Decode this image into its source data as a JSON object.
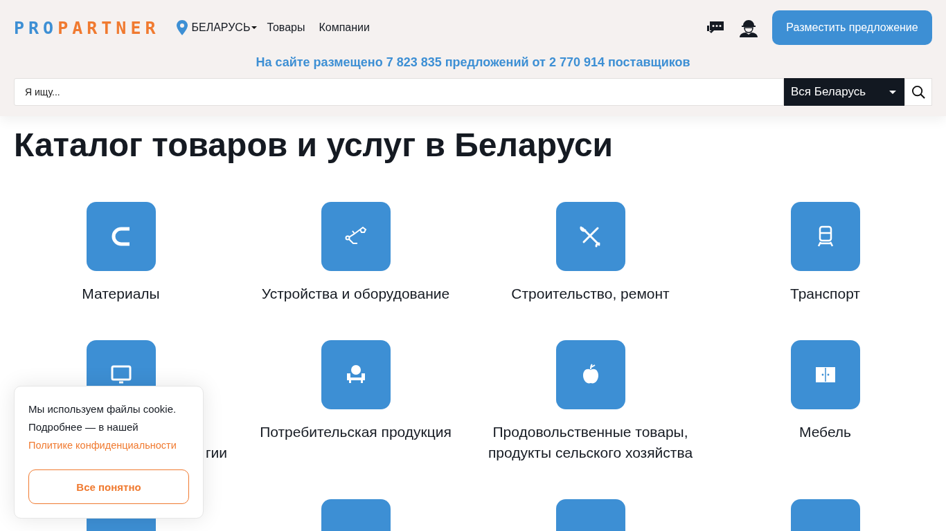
{
  "header": {
    "logo": {
      "part_1": "PRO",
      "part_2": "PARTNER"
    },
    "region": "БЕЛАРУСЬ",
    "nav": [
      "Товары",
      "Компании"
    ],
    "post_button": "Разместить предложение",
    "stats": "На сайте размещено 7 823 835 предложений от 2 770 914 поставщиков",
    "search": {
      "placeholder": "Я ищу...",
      "region_select": "Вся Беларусь"
    }
  },
  "title": "Каталог товаров и услуг в Беларуси",
  "categories": [
    {
      "label": "Материалы",
      "kind": "full"
    },
    {
      "label": "Устройства и оборудование",
      "kind": "full"
    },
    {
      "label": "Строительство, ремонт",
      "kind": "full"
    },
    {
      "label": "Транспорт",
      "kind": "full"
    },
    {
      "label": "гии",
      "kind": "partial"
    },
    {
      "label": "Потребительская продукция",
      "kind": "full"
    },
    {
      "label": "Продовольственные товары, продукты сельского хозяйства",
      "kind": "full"
    },
    {
      "label": "Мебель",
      "kind": "full"
    },
    {
      "kind": "cut"
    },
    {
      "kind": "cut"
    },
    {
      "kind": "cut"
    },
    {
      "kind": "cut"
    }
  ],
  "cookie": {
    "line_1": "Мы используем файлы cookie.",
    "line_2": "Подробнее — в нашей",
    "link": "Политике конфиденциальности",
    "button": "Все понятно"
  }
}
